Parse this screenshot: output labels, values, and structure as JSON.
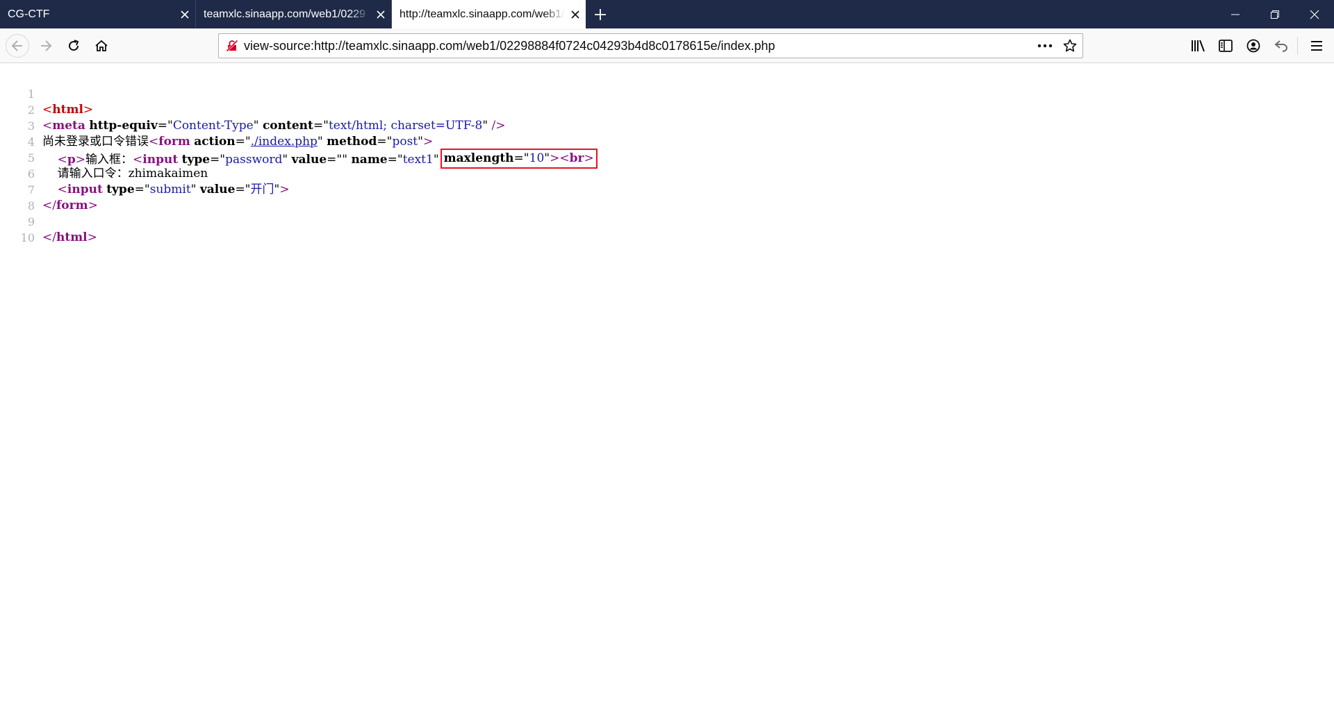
{
  "tabs": [
    {
      "title": "CG-CTF"
    },
    {
      "title": "teamxlc.sinaapp.com/web1/0229"
    },
    {
      "title": "http://teamxlc.sinaapp.com/web1/"
    }
  ],
  "address_bar": {
    "url": "view-source:http://teamxlc.sinaapp.com/web1/02298884f0724c04293b4d8c0178615e/index.php"
  },
  "icons": {
    "back": "back-arrow-icon",
    "forward": "forward-arrow-icon",
    "reload": "reload-icon",
    "home": "home-icon",
    "insecure": "insecure-connection-icon",
    "page_actions": "more-dots-icon",
    "bookmark": "star-icon",
    "library": "library-icon",
    "sidebar": "sidebar-icon",
    "account": "account-icon",
    "undo": "undo-icon",
    "menu": "hamburger-menu-icon"
  },
  "source": {
    "line_numbers": [
      "1",
      "2",
      "3",
      "4",
      "5",
      "6",
      "7",
      "8",
      "9",
      "10"
    ],
    "l1": {
      "open": "<",
      "name": "html",
      "close": ">"
    },
    "l2": {
      "open": "<",
      "name": "meta",
      "attr1": "http-equiv",
      "eq1": "=\"",
      "val1": "Content-Type",
      "q1": "\" ",
      "attr2": "content",
      "eq2": "=\"",
      "val2": "text/html; charset=UTF-8",
      "q2": "\" ",
      "close": "/>"
    },
    "l3": {
      "text": "尚未登录或口令错误",
      "open": "<",
      "name": "form",
      "attr1": "action",
      "eq1": "=\"",
      "val1": "./index.php",
      "q1": "\" ",
      "attr2": "method",
      "eq2": "=\"",
      "val2": "post",
      "q2": "\"",
      "close": ">"
    },
    "l4": {
      "indent": "    ",
      "p_open": "<",
      "p_name": "p",
      "p_close": ">",
      "label": "输入框：",
      "open": "<",
      "name": "input",
      "attr1": "type",
      "eq1": "=\"",
      "val1": "password",
      "q1": "\" ",
      "attr2": "value",
      "eq2": "=\"\" ",
      "attr3": "name",
      "eq3": "=\"",
      "val3": "text1",
      "q3": "\"",
      "attr4": "maxlength",
      "eq4": "=\"",
      "val4": "10",
      "q4": "\"",
      "close": ">",
      "br_open": "<",
      "br_name": "br",
      "br_close": ">"
    },
    "l5": {
      "indent": "    ",
      "text": "请输入口令：zhimakaimen"
    },
    "l6": {
      "indent": "    ",
      "open": "<",
      "name": "input",
      "attr1": "type",
      "eq1": "=\"",
      "val1": "submit",
      "q1": "\" ",
      "attr2": "value",
      "eq2": "=\"",
      "val2": "开门",
      "q2": "\"",
      "close": ">"
    },
    "l7": {
      "open": "</",
      "name": "form",
      "close": ">"
    },
    "l9": {
      "open": "</",
      "name": "html",
      "close": ">"
    }
  },
  "colors": {
    "tab_bar": "#1e2a47",
    "tag": "#881280",
    "value": "#1a1aa6",
    "annotation_box": "#e81123"
  }
}
